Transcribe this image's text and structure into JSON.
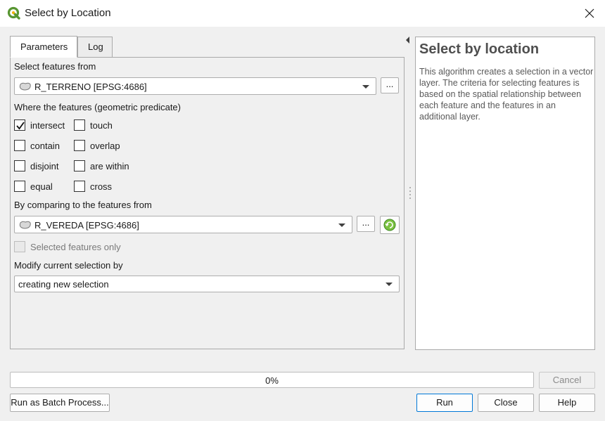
{
  "window": {
    "title": "Select by Location",
    "close_glyph": "✕"
  },
  "tabs": [
    {
      "label": "Parameters",
      "active": true
    },
    {
      "label": "Log",
      "active": false
    }
  ],
  "params": {
    "input_layer_label": "Select features from",
    "input_layer_value": "R_TERRENO [EPSG:4686]",
    "predicate_label": "Where the features (geometric predicate)",
    "predicates": [
      {
        "label": "intersect",
        "checked": true
      },
      {
        "label": "touch",
        "checked": false
      },
      {
        "label": "contain",
        "checked": false
      },
      {
        "label": "overlap",
        "checked": false
      },
      {
        "label": "disjoint",
        "checked": false
      },
      {
        "label": "are within",
        "checked": false
      },
      {
        "label": "equal",
        "checked": false
      },
      {
        "label": "cross",
        "checked": false
      }
    ],
    "compare_label": "By comparing to the features from",
    "compare_value": "R_VEREDA [EPSG:4686]",
    "selected_only_label": "Selected features only",
    "modify_label": "Modify current selection by",
    "modify_value": "creating new selection",
    "ellipsis": "..."
  },
  "help": {
    "title": "Select by location",
    "body": "This algorithm creates a selection in a vector layer. The criteria for selecting features is based on the spatial relationship between each feature and the features in an additional layer."
  },
  "progress": {
    "value": 0,
    "text": "0%"
  },
  "buttons": {
    "cancel": "Cancel",
    "batch": "Run as Batch Process...",
    "run": "Run",
    "close": "Close",
    "help": "Help"
  },
  "colors": {
    "accent": "#0078d7",
    "qgis_green": "#589632",
    "qgis_yellow": "#ee7913"
  }
}
